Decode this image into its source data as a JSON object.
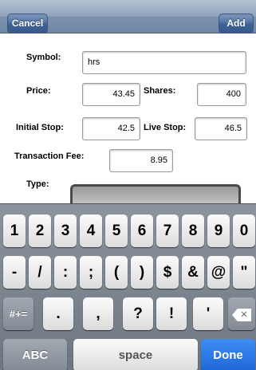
{
  "navbar": {
    "cancel_label": "Cancel",
    "add_label": "Add"
  },
  "form": {
    "symbol_label": "Symbol:",
    "symbol_value": "hrs",
    "price_label": "Price:",
    "price_value": "43.45",
    "shares_label": "Shares:",
    "shares_value": "400",
    "initial_stop_label": "Initial Stop:",
    "initial_stop_value": "42.5",
    "live_stop_label": "Live Stop:",
    "live_stop_value": "46.5",
    "fee_label": "Transaction Fee:",
    "fee_value": "8.95",
    "type_label": "Type:"
  },
  "keyboard": {
    "row1": [
      "1",
      "2",
      "3",
      "4",
      "5",
      "6",
      "7",
      "8",
      "9",
      "0"
    ],
    "row2": [
      "-",
      "/",
      ":",
      ";",
      "(",
      ")",
      "$",
      "&",
      "@",
      "\""
    ],
    "row3": [
      ".",
      ",",
      "?",
      "!",
      "'"
    ],
    "shift_label": "#+=",
    "backspace_icon": "backspace-icon",
    "abc_label": "ABC",
    "space_label": "space",
    "done_label": "Done"
  },
  "colors": {
    "navbar": "#8ea2bb",
    "nav_button": "#4d6f9d",
    "keyboard_bg": "#7d8590",
    "done_key": "#2a76e6"
  }
}
